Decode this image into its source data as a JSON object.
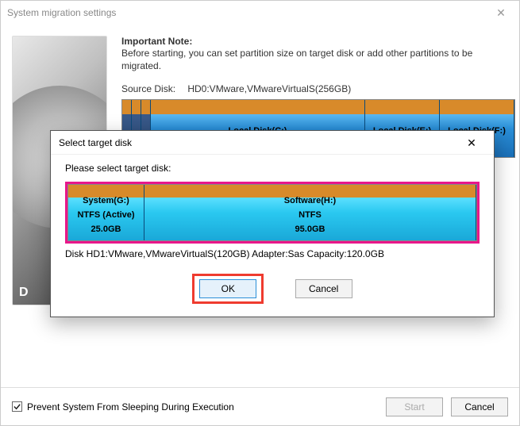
{
  "main": {
    "title": "System migration settings",
    "note_title": "Important Note:",
    "note_body": "Before starting, you can set partition size on target disk or add other partitions to be migrated.",
    "source_label": "Source Disk:",
    "source_value": "HD0:VMware,VMwareVirtualS(256GB)",
    "partitions": {
      "c": "Local Disk(C:)",
      "e": "Local Disk(E:)",
      "f": "Local Disk(F:)"
    },
    "hdd_label": "D",
    "prevent_sleep": "Prevent System From Sleeping During Execution",
    "start": "Start",
    "cancel": "Cancel"
  },
  "modal": {
    "title": "Select target disk",
    "prompt": "Please select target disk:",
    "g": {
      "name": "System(G:)",
      "fs": "NTFS (Active)",
      "size": "25.0GB"
    },
    "h": {
      "name": "Software(H:)",
      "fs": "NTFS",
      "size": "95.0GB"
    },
    "disk_info": "Disk HD1:VMware,VMwareVirtualS(120GB)  Adapter:Sas  Capacity:120.0GB",
    "ok": "OK",
    "cancel": "Cancel"
  }
}
